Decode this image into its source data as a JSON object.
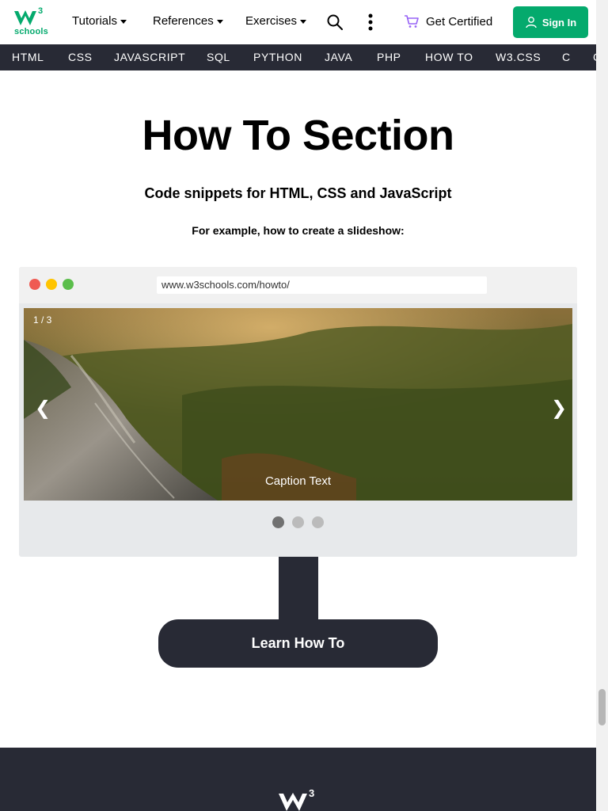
{
  "header": {
    "logo_superscript": "3",
    "logo_text": "schools",
    "menus": [
      {
        "label": "Tutorials"
      },
      {
        "label": "References"
      },
      {
        "label": "Exercises"
      }
    ],
    "certified_label": "Get Certified",
    "signin_label": "Sign In"
  },
  "subnav": {
    "items": [
      "HTML",
      "CSS",
      "JAVASCRIPT",
      "SQL",
      "PYTHON",
      "JAVA",
      "PHP",
      "HOW TO",
      "W3.CSS",
      "C",
      "C"
    ]
  },
  "main": {
    "title": "How To Section",
    "subtitle": "Code snippets for HTML, CSS and JavaScript",
    "example_text": "For example, how to create a slideshow:"
  },
  "browser": {
    "url": "www.w3schools.com/howto/",
    "counter": "1 / 3",
    "caption": "Caption Text",
    "prev_label": "❮",
    "next_label": "❯",
    "slide_count": 3,
    "active_slide": 1
  },
  "cta": {
    "label": "Learn How To"
  },
  "colors": {
    "brand": "#04AA6D",
    "dark": "#282A35",
    "dot_red": "#EF5B53",
    "dot_yellow": "#FFC400",
    "dot_green": "#5BBE4B"
  },
  "icons": [
    "search-icon",
    "more-vertical-icon",
    "cart-icon",
    "user-icon",
    "chevron-left-icon",
    "chevron-right-icon"
  ]
}
